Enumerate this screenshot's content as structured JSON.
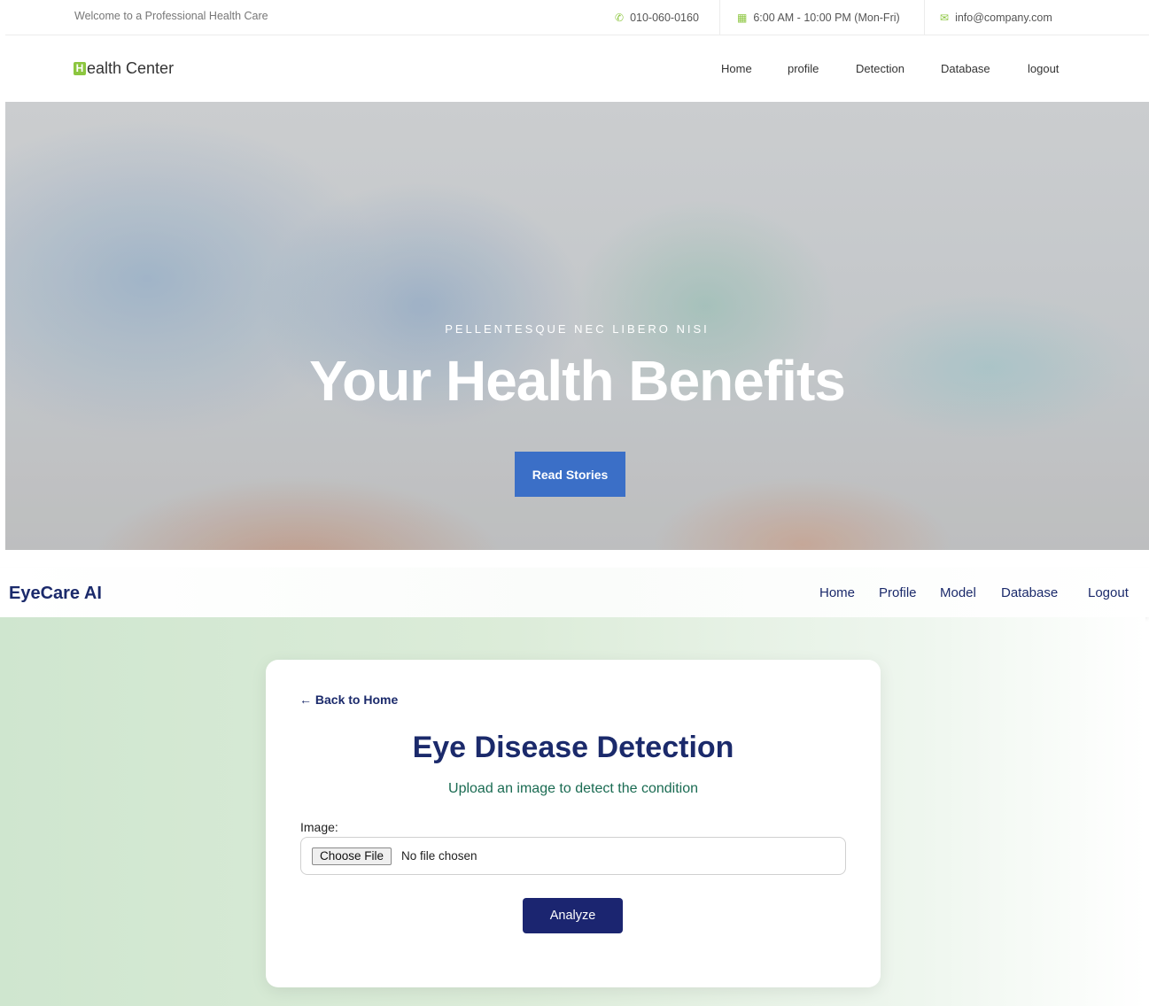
{
  "topbar": {
    "welcome": "Welcome to a Professional Health Care",
    "phone": "010-060-0160",
    "hours": "6:00 AM - 10:00 PM (Mon-Fri)",
    "email": "info@company.com",
    "phone_icon": "phone-icon",
    "calendar_icon": "calendar-icon",
    "mail_icon": "mail-icon"
  },
  "health_center": {
    "brand_mark": "H",
    "brand_rest": "ealth Center",
    "menu": [
      "Home",
      "profile",
      "Detection",
      "Database",
      "logout"
    ]
  },
  "hero": {
    "kicker": "PELLENTESQUE NEC LIBERO NISI",
    "headline": "Your Health Benefits",
    "cta": "Read Stories"
  },
  "eyecare": {
    "brand": "EyeCare AI",
    "menu": [
      "Home",
      "Profile",
      "Model",
      "Database",
      "Logout"
    ],
    "back_link": "← Back to Home",
    "title": "Eye Disease Detection",
    "subtitle": "Upload an image to detect the condition",
    "field_label": "Image:",
    "file_button": "Choose File",
    "file_status": "No file chosen",
    "analyze": "Analyze"
  },
  "colors": {
    "accent_green": "#8cc63f",
    "hero_button": "#3b6fc7",
    "navy": "#1b2a6b",
    "teal_text": "#1a6b52",
    "analyze_button": "#1b2570"
  }
}
